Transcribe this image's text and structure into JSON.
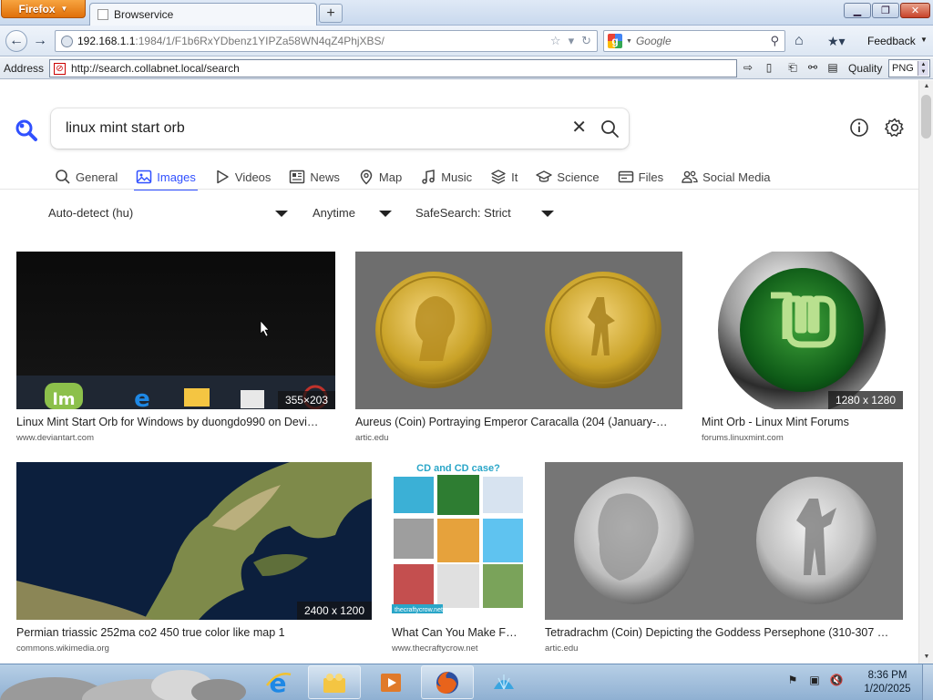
{
  "browser": {
    "menu_button": "Firefox",
    "tab_title": "Browservice",
    "new_tab": "+",
    "url_host": "192.168.1.1",
    "url_path": ":1984/1/F1b6RxYDbenz1YIPZa58WN4qZ4PhjXBS/",
    "search_engine_placeholder": "Google",
    "feedback_label": "Feedback",
    "address_label": "Address",
    "address_value": "http://search.collabnet.local/search",
    "quality_label": "Quality",
    "quality_value": "PNG"
  },
  "search": {
    "query": "linux mint start orb"
  },
  "categories": [
    {
      "label": "General",
      "icon": "search-icon",
      "active": false
    },
    {
      "label": "Images",
      "icon": "image-icon",
      "active": true
    },
    {
      "label": "Videos",
      "icon": "play-icon",
      "active": false
    },
    {
      "label": "News",
      "icon": "newspaper-icon",
      "active": false
    },
    {
      "label": "Map",
      "icon": "map-pin-icon",
      "active": false
    },
    {
      "label": "Music",
      "icon": "music-note-icon",
      "active": false
    },
    {
      "label": "It",
      "icon": "layers-icon",
      "active": false
    },
    {
      "label": "Science",
      "icon": "graduation-cap-icon",
      "active": false
    },
    {
      "label": "Files",
      "icon": "drive-icon",
      "active": false
    },
    {
      "label": "Social Media",
      "icon": "people-icon",
      "active": false
    }
  ],
  "filters": {
    "language": "Auto-detect (hu)",
    "time": "Anytime",
    "safesearch": "SafeSearch: Strict"
  },
  "results": [
    {
      "title": "Linux Mint Start Orb for Windows by duongdo990 on Devi…",
      "source": "www.deviantart.com",
      "dims": "355×203"
    },
    {
      "title": "Aureus (Coin) Portraying Emperor Caracalla (204 (January-…",
      "source": "artic.edu",
      "dims": ""
    },
    {
      "title": "Mint Orb - Linux Mint Forums",
      "source": "forums.linuxmint.com",
      "dims": "1280 x 1280"
    },
    {
      "title": "Permian triassic 252ma co2 450 true color like map 1",
      "source": "commons.wikimedia.org",
      "dims": "2400 x 1200"
    },
    {
      "title": "What Can You Make F…",
      "source": "www.thecraftycrow.net",
      "dims": "",
      "thumb_heading": "CD and CD case?",
      "thumb_watermark": "thecraftycrow.net"
    },
    {
      "title": "Tetradrachm (Coin) Depicting the Goddess Persephone (310-307 …",
      "source": "artic.edu",
      "dims": ""
    }
  ],
  "taskbar": {
    "apps": [
      "internet-explorer",
      "windows-explorer",
      "media-player",
      "firefox",
      "shell-app"
    ],
    "time": "8:36 PM",
    "date": "1/20/2025"
  },
  "colors": {
    "accent": "#3050ff",
    "mint_green": "#6fb92b",
    "gold": "#c9a227"
  }
}
